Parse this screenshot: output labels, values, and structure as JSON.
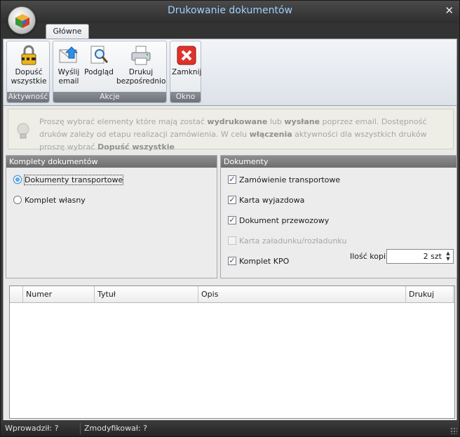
{
  "window": {
    "title": "Drukowanie dokumentów",
    "close_glyph": "✕"
  },
  "tabs": [
    {
      "label": "Główne",
      "active": true
    }
  ],
  "ribbon": {
    "groups": [
      {
        "label": "Aktywność",
        "buttons": [
          {
            "label": "Dopuść wszystkie",
            "icon": "lock-icon"
          }
        ]
      },
      {
        "label": "Akcje",
        "buttons": [
          {
            "label": "Wyślij email",
            "icon": "email-send-icon"
          },
          {
            "label": "Podgląd",
            "icon": "preview-icon"
          },
          {
            "label": "Drukuj bezpośrednio",
            "icon": "printer-icon"
          }
        ]
      },
      {
        "label": "Okno",
        "buttons": [
          {
            "label": "Zamknij",
            "icon": "close-red-icon"
          }
        ]
      }
    ]
  },
  "info": {
    "icon": "lightbulb-icon",
    "part1": "Proszę wybrać elementy które mają zostać ",
    "bold1": "wydrukowane",
    "part2": " lub ",
    "bold2": "wysłane",
    "part3": " poprzez email. Dostępność druków zależy od etapu realizacji zamówienia. W celu ",
    "bold3": "włączenia",
    "part4": " aktywności dla wszystkich druków proszę wybrać ",
    "bold4": "Dopuść wszystkie"
  },
  "sets_panel": {
    "title": "Komplety dokumentów",
    "options": [
      {
        "label": "Dokumenty transportowe",
        "selected": true
      },
      {
        "label": "Komplet własny",
        "selected": false
      }
    ]
  },
  "docs_panel": {
    "title": "Dokumenty",
    "items": [
      {
        "label": "Zamówienie transportowe",
        "checked": true,
        "enabled": true
      },
      {
        "label": "Karta wyjazdowa",
        "checked": true,
        "enabled": true
      },
      {
        "label": "Dokument przewozowy",
        "checked": true,
        "enabled": true
      },
      {
        "label": "Karta załadunku/rozładunku",
        "checked": false,
        "enabled": false
      },
      {
        "label": "Komplet KPO",
        "checked": true,
        "enabled": true
      }
    ],
    "copies_label": "Ilość kopi:",
    "copies_value": "2 szt"
  },
  "grid": {
    "columns": [
      "",
      "Numer",
      "Tytuł",
      "Opis",
      "Drukuj"
    ],
    "rows": []
  },
  "statusbar": {
    "entered_by": "Wprowadził:  ?",
    "modified_by": "Zmodyfikował:  ?"
  }
}
